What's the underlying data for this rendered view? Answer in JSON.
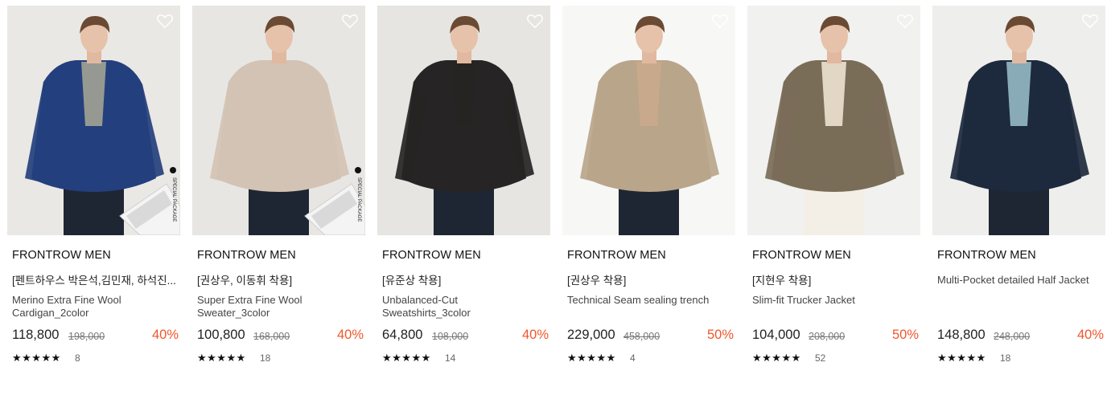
{
  "products": [
    {
      "brand": "FRONTROW MEN",
      "tag": "[펜트하우스 박은석,김민재, 하석진...",
      "name": "Merino Extra Fine Wool Cardigan_2color",
      "price": "118,800",
      "original_price": "198,000",
      "discount": "40%",
      "stars": "★★★★★",
      "reviews": "8",
      "image": {
        "subject": "model in blue cardigan",
        "bg": "#e9e8e4",
        "garment": "#243f7d",
        "package_badge": "SPECIAL PACKAGE"
      }
    },
    {
      "brand": "FRONTROW MEN",
      "tag": "[권상우, 이동휘 착용]",
      "name": "Super Extra Fine Wool Sweater_3color",
      "price": "100,800",
      "original_price": "168,000",
      "discount": "40%",
      "stars": "★★★★★",
      "reviews": "18",
      "image": {
        "subject": "model in beige sweater",
        "bg": "#e8e6e2",
        "garment": "#d2c3b4",
        "package_badge": "SPECIAL PACKAGE"
      }
    },
    {
      "brand": "FRONTROW MEN",
      "tag": "[유준상 착용]",
      "name": "Unbalanced-Cut Sweatshirts_3color",
      "price": "64,800",
      "original_price": "108,000",
      "discount": "40%",
      "stars": "★★★★★",
      "reviews": "14",
      "image": {
        "subject": "model in black sweatshirt",
        "bg": "#e6e5e1",
        "garment": "#262424"
      }
    },
    {
      "brand": "FRONTROW MEN",
      "tag": "[권상우 착용]",
      "name": "Technical Seam sealing trench",
      "price": "229,000",
      "original_price": "458,000",
      "discount": "50%",
      "stars": "★★★★★",
      "reviews": "4",
      "image": {
        "subject": "model in beige trench coat",
        "bg": "#f7f7f6",
        "garment": "#b9a58a"
      }
    },
    {
      "brand": "FRONTROW MEN",
      "tag": "[지현우 착용]",
      "name": "Slim-fit Trucker Jacket",
      "price": "104,000",
      "original_price": "208,000",
      "discount": "50%",
      "stars": "★★★★★",
      "reviews": "52",
      "image": {
        "subject": "model in khaki trucker jacket",
        "bg": "#f1f1ef",
        "garment": "#7a6d58"
      }
    },
    {
      "brand": "FRONTROW MEN",
      "tag": "",
      "name": "Multi-Pocket detailed Half Jacket",
      "price": "148,800",
      "original_price": "248,000",
      "discount": "40%",
      "stars": "★★★★★",
      "reviews": "18",
      "image": {
        "subject": "model in navy jacket",
        "bg": "#eeeeec",
        "garment": "#1d2a3d"
      }
    }
  ],
  "colors": {
    "discount": "#f0562a",
    "text": "#222222",
    "muted": "#777777"
  },
  "icons": {
    "wishlist": "heart-outline-icon",
    "rating": "star-icon"
  }
}
